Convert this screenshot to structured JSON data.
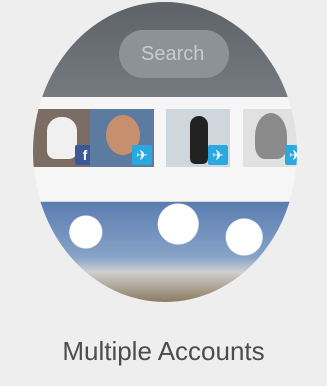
{
  "search": {
    "label": "Search"
  },
  "accounts": [
    {
      "service": "Facebook",
      "badge": "f",
      "badge_color": "#3b5998"
    },
    {
      "service": "Twitter",
      "badge": "✈",
      "badge_color": "#2aa9e0"
    },
    {
      "service": "Twitter",
      "badge": "✈",
      "badge_color": "#2aa9e0"
    },
    {
      "service": "Twitter",
      "badge": "✈",
      "badge_color": "#2aa9e0"
    }
  ],
  "caption": {
    "title": "Multiple Accounts"
  },
  "colors": {
    "background": "#eeeeee",
    "topbar": "#6b7076",
    "text": "#4c4c4c"
  }
}
